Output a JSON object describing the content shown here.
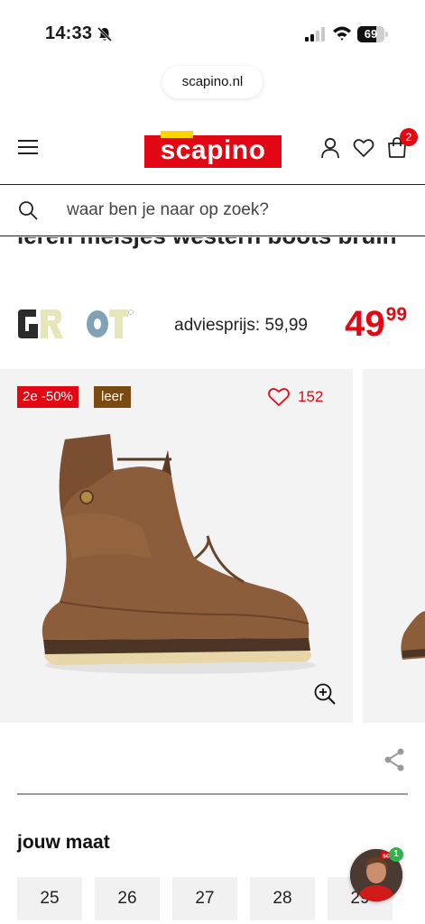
{
  "status_bar": {
    "time": "14:33",
    "battery": "69",
    "battery_level": 0.69,
    "icons": [
      "bell-off-icon",
      "signal-icon",
      "wifi-icon",
      "battery-icon"
    ]
  },
  "browser": {
    "url": "scapino.nl"
  },
  "header": {
    "logo_text": "scapino",
    "cart_count": "2",
    "icons": [
      "menu-icon",
      "user-icon",
      "heart-icon",
      "shopping-bag-icon"
    ]
  },
  "search": {
    "placeholder": "waar ben je naar op zoek?",
    "value": ""
  },
  "product": {
    "title": "leren meisjes western boots bruin",
    "brand_logo": "GROOT",
    "advice_price": "adviesprijs: 59,99",
    "price_main": "49",
    "price_cents": "99",
    "badges": {
      "promo": "2e -50%",
      "material": "leer"
    },
    "wishlist_count": "152"
  },
  "sizes": {
    "heading": "jouw maat",
    "options": [
      "25",
      "26",
      "27",
      "28",
      "29"
    ]
  },
  "chat": {
    "badge": "1",
    "avatar_logo": "sca"
  },
  "colors": {
    "brand_red": "#e30613",
    "brand_yellow": "#ffd400",
    "material_badge": "#7b4a12",
    "chat_badge": "#2fb34a"
  }
}
